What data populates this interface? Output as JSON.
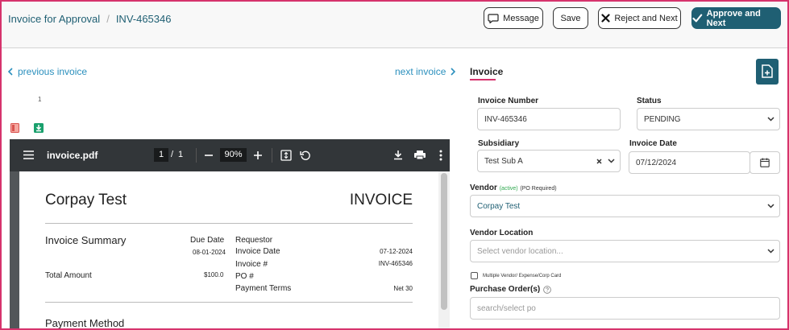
{
  "header": {
    "breadcrumb_root": "Invoice for Approval",
    "breadcrumb_sep": "/",
    "breadcrumb_current": "INV-465346",
    "message_label": "Message",
    "save_label": "Save",
    "reject_label": "Reject and Next",
    "approve_label": "Approve and Next"
  },
  "nav": {
    "prev_label": "previous invoice",
    "next_label": "next invoice"
  },
  "attachments": {
    "count": "1"
  },
  "viewer": {
    "filename": "invoice.pdf",
    "page_current": "1",
    "page_sep": "/",
    "page_total": "1",
    "zoom": "90%"
  },
  "doc": {
    "company": "Corpay Test",
    "heading": "INVOICE",
    "summary_title": "Invoice Summary",
    "due_date_label": "Due Date",
    "due_date_value": "08-01-2024",
    "requestor_label": "Requestor",
    "invoice_date_label": "Invoice Date",
    "invoice_date_value": "07-12-2024",
    "invoice_no_label": "Invoice #",
    "invoice_no_value": "INV-465346",
    "total_label": "Total Amount",
    "total_value": "$100.0",
    "po_label": "PO #",
    "terms_label": "Payment Terms",
    "terms_value": "Net 30",
    "payment_method_label": "Payment Method"
  },
  "form": {
    "tab_label": "Invoice",
    "invoice_number_label": "Invoice Number",
    "invoice_number_value": "INV-465346",
    "status_label": "Status",
    "status_value": "PENDING",
    "subsidiary_label": "Subsidiary",
    "subsidiary_value": "Test Sub A",
    "invoice_date_label": "Invoice Date",
    "invoice_date_value": "07/12/2024",
    "vendor_label": "Vendor",
    "vendor_active": "(active)",
    "vendor_po_note": "(PO Required)",
    "vendor_value": "Corpay Test",
    "vendor_location_label": "Vendor Location",
    "vendor_location_placeholder": "Select vendor location...",
    "multi_vendor_label": "Multiple Vendor/ Expense/Corp Card",
    "po_label": "Purchase Order(s)",
    "po_placeholder": "search/select po"
  },
  "colors": {
    "accent": "#1f5f73",
    "link": "#2a8fbd",
    "active": "#2fa84f",
    "highlight": "#d6336c"
  }
}
